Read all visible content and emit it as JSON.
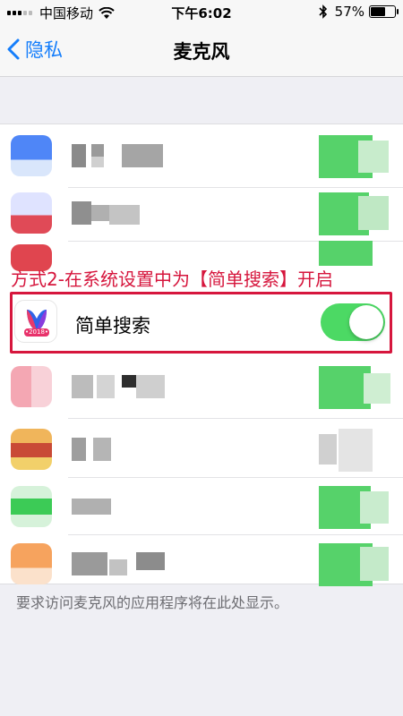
{
  "status_bar": {
    "carrier": "中国移动",
    "time": "下午6:02",
    "battery_percent": "57%",
    "battery_level": 0.57
  },
  "nav": {
    "back_label": "隐私",
    "title": "麦克风"
  },
  "annotation": {
    "text": "方式2-在系统设置中为【简单搜索】开启",
    "color": "#d6163d"
  },
  "highlighted_app": {
    "name": "简单搜索",
    "icon_badge": "•2018•",
    "toggle_on": true
  },
  "footer": {
    "text": "要求访问麦克风的应用程序将在此处显示。"
  },
  "colors": {
    "accent": "#157efb",
    "toggle_on": "#4cd964",
    "background": "#efeff4"
  }
}
